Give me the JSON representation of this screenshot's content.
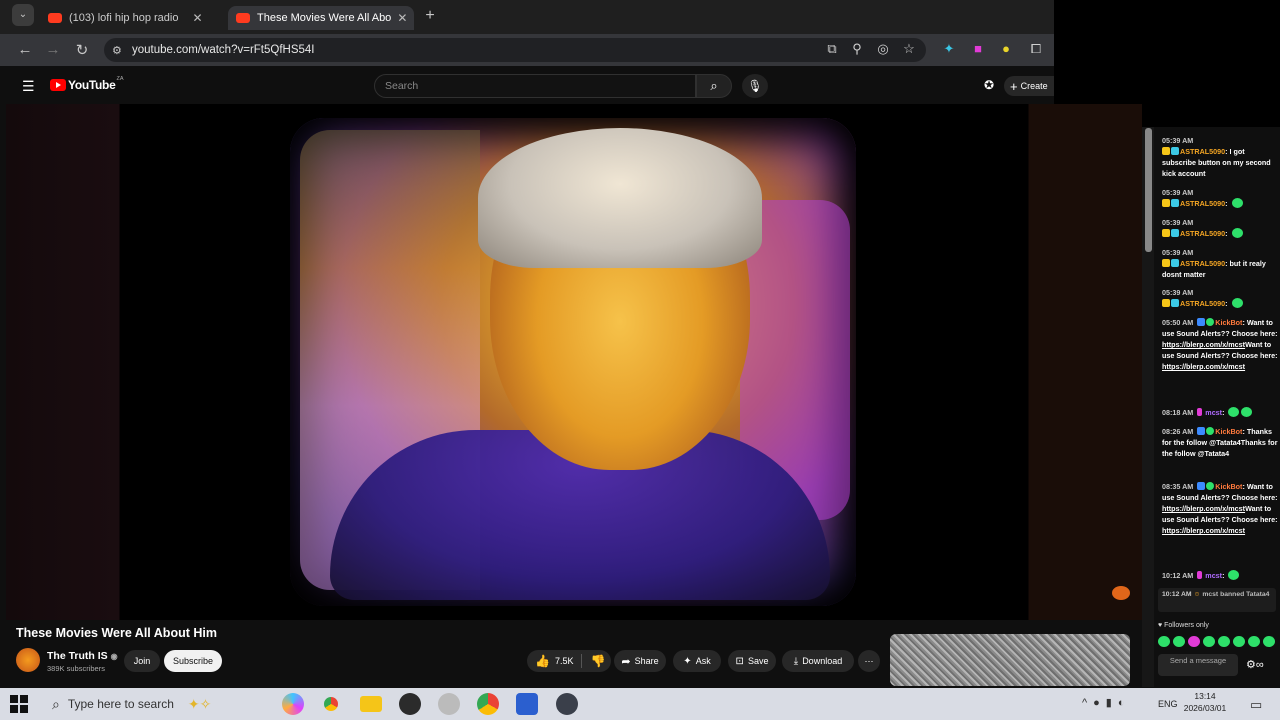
{
  "browser": {
    "tabs": [
      {
        "label": "(103) lofi hip hop radio",
        "active": false
      },
      {
        "label": "These Movies Were All Abo",
        "active": true
      }
    ],
    "new_tab_icon": "plus-icon",
    "url": "youtube.com/watch?v=rFt5QfHS54I"
  },
  "youtube": {
    "logo_text": "YouTube",
    "logo_region": "ZA",
    "search_placeholder": "Search",
    "create_label": "Create",
    "video_title": "These Movies Were All About Him",
    "channel_name": "The Truth IS",
    "channel_subscribers": "389K subscribers",
    "join_label": "Join",
    "subscribe_label": "Subscribe",
    "like_count": "7.5K",
    "share_label": "Share",
    "ask_label": "Ask",
    "save_label": "Save",
    "download_label": "Download",
    "more_label": "⋯"
  },
  "chat": {
    "messages": [
      {
        "time": "05:39 AM",
        "user": "ASTRAL5090",
        "text": "I got subscribe button on my second kick account"
      },
      {
        "time": "05:39 AM",
        "user": "ASTRAL5090",
        "text": ""
      },
      {
        "time": "05:39 AM",
        "user": "ASTRAL5090",
        "text": ""
      },
      {
        "time": "05:39 AM",
        "user": "ASTRAL5090",
        "text": "but it realy dosnt matter"
      },
      {
        "time": "05:39 AM",
        "user": "ASTRAL5090",
        "text": ""
      },
      {
        "time": "05:50 AM",
        "user": "KickBot",
        "text": "Want to use Sound Alerts?? Choose here:",
        "link": "https://blerp.com/x/mcst",
        "text2": "Want to use Sound Alerts?? Choose here:",
        "link2": "https://blerp.com/x/mcst"
      },
      {
        "time": "08:18 AM",
        "user": "mcst",
        "text": ""
      },
      {
        "time": "08:26 AM",
        "user": "KickBot",
        "text": "Thanks for the follow @Tatata4Thanks for the follow @Tatata4"
      },
      {
        "time": "08:35 AM",
        "user": "KickBot",
        "text": "Want to use Sound Alerts?? Choose here:",
        "link": "https://blerp.com/x/mcst",
        "text2": "Want to use Sound Alerts?? Choose here:",
        "link2": "https://blerp.com/x/mcst"
      },
      {
        "time": "10:12 AM",
        "user": "mcst",
        "text": ""
      }
    ],
    "ban_note_time": "10:12 AM",
    "ban_note_text": "mcst banned Tatata4",
    "followers_only": "Followers only",
    "send_placeholder": "Send a message"
  },
  "taskbar": {
    "search_placeholder": "Type here to search",
    "language": "ENG",
    "time": "13:14",
    "date": "2026/03/01"
  },
  "colors": {
    "youtube_red": "#ff0000",
    "kick_green": "#2ee06a",
    "username_gold": "#f5a623"
  }
}
